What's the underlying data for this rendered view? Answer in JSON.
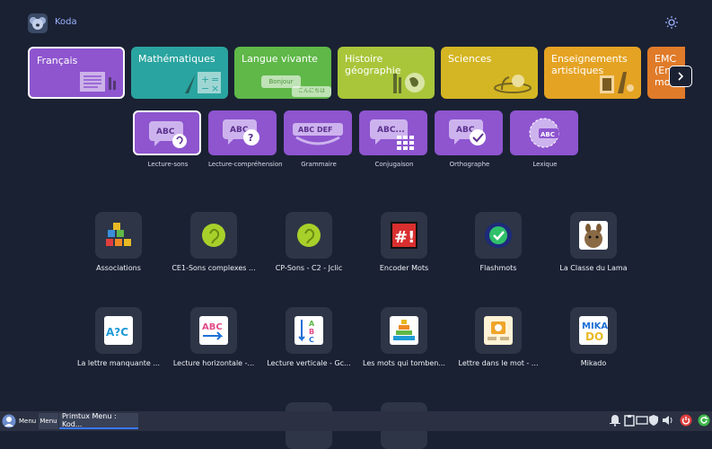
{
  "header": {
    "app_name": "Koda"
  },
  "subjects": [
    {
      "label": "Français",
      "color": "#8e55cf",
      "active": true
    },
    {
      "label": "Mathématiques",
      "color": "#2aa4a0"
    },
    {
      "label": "Langue vivante",
      "color": "#5fb848",
      "bubble": "Bonjour",
      "bubble2": "こんにちは"
    },
    {
      "label": "Histoire géographie",
      "color": "#a9c63a"
    },
    {
      "label": "Sciences",
      "color": "#d4b624"
    },
    {
      "label": "Enseignements artistiques",
      "color": "#e5a323"
    },
    {
      "label": "EMC (En mo",
      "color": "#e07b2a"
    }
  ],
  "skills": [
    {
      "label": "Lecture-sons",
      "badge": "ABC",
      "active": true
    },
    {
      "label": "Lecture-compréhension",
      "badge": "ABC"
    },
    {
      "label": "Grammaire",
      "badge": "ABC DEF"
    },
    {
      "label": "Conjugaison",
      "badge": "ABC..."
    },
    {
      "label": "Orthographe",
      "badge": "ABC"
    },
    {
      "label": "Lexique",
      "badge": "ABC"
    }
  ],
  "apps_row1": [
    {
      "label": "Associations",
      "icon": "alphabet-blocks-icon",
      "color": "#2d3547"
    },
    {
      "label": "CE1-Sons complexes ...",
      "icon": "ear-icon",
      "color": "#a8d02a"
    },
    {
      "label": "CP-Sons - C2 - Jclic",
      "icon": "ear-icon",
      "color": "#a8d02a"
    },
    {
      "label": "Encoder Mots",
      "icon": "hash-bang-icon",
      "color": "#1a1a1a"
    },
    {
      "label": "Flashmots",
      "icon": "check-shield-icon",
      "color": "#2a7de0"
    },
    {
      "label": "La Classe du Lama",
      "icon": "lama-icon",
      "color": "#ffffff"
    }
  ],
  "apps_row2": [
    {
      "label": "La lettre manquante ...",
      "icon": "letter-missing-icon",
      "color": "#ffffff",
      "glyph": "A?C"
    },
    {
      "label": "Lecture horizontale -...",
      "icon": "abc-arrow-icon",
      "color": "#ffffff",
      "glyph": "ABC"
    },
    {
      "label": "Lecture verticale - Gc...",
      "icon": "abc-vertical-icon",
      "color": "#ffffff",
      "glyph": "ABC"
    },
    {
      "label": "Les mots qui tomben...",
      "icon": "pyramid-icon",
      "color": "#ffffff"
    },
    {
      "label": "Lettre dans le mot - ...",
      "icon": "letter-in-word-icon",
      "color": "#fff3d6"
    },
    {
      "label": "Mikado",
      "icon": "mikado-icon",
      "color": "#ffffff",
      "glyph": "MIKA DO"
    }
  ],
  "taskbar": {
    "menu1": "Menu",
    "menu2": "Menu",
    "task": "Primtux Menu : Kod..."
  }
}
